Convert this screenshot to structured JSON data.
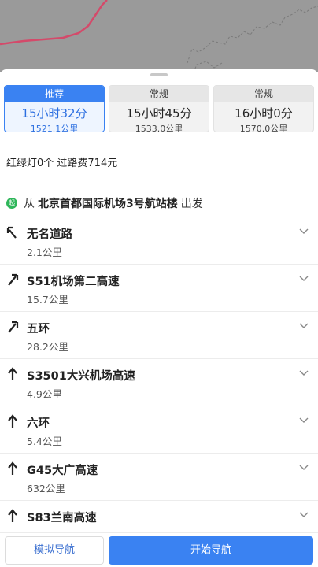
{
  "map": {
    "route_color": "#d44a6a"
  },
  "routes": [
    {
      "tag": "推荐",
      "duration": "15小时32分",
      "distance": "1521.1公里",
      "active": true
    },
    {
      "tag": "常规",
      "duration": "15小时45分",
      "distance": "1533.0公里",
      "active": false
    },
    {
      "tag": "常规",
      "duration": "16小时0分",
      "distance": "1570.0公里",
      "active": false
    }
  ],
  "summary": "红绿灯0个 过路费714元",
  "start": {
    "badge": "起",
    "prefix": "从",
    "place": "北京首都国际机场3号航站楼",
    "suffix": "出发"
  },
  "steps": [
    {
      "icon": "turn-left-icon",
      "road": "无名道路",
      "distance": "2.1公里"
    },
    {
      "icon": "slight-right-icon",
      "road": "S51机场第二高速",
      "distance": "15.7公里"
    },
    {
      "icon": "slight-right-icon",
      "road": "五环",
      "distance": "28.2公里"
    },
    {
      "icon": "straight-icon",
      "road": "S3501大兴机场高速",
      "distance": "4.9公里"
    },
    {
      "icon": "straight-icon",
      "road": "六环",
      "distance": "5.4公里"
    },
    {
      "icon": "straight-icon",
      "road": "G45大广高速",
      "distance": "632公里"
    },
    {
      "icon": "straight-icon",
      "road": "S83兰南高速",
      "distance": ""
    }
  ],
  "buttons": {
    "simulate": "模拟导航",
    "start": "开始导航"
  },
  "colors": {
    "accent": "#3a82f2",
    "start_badge": "#2fb65a"
  }
}
